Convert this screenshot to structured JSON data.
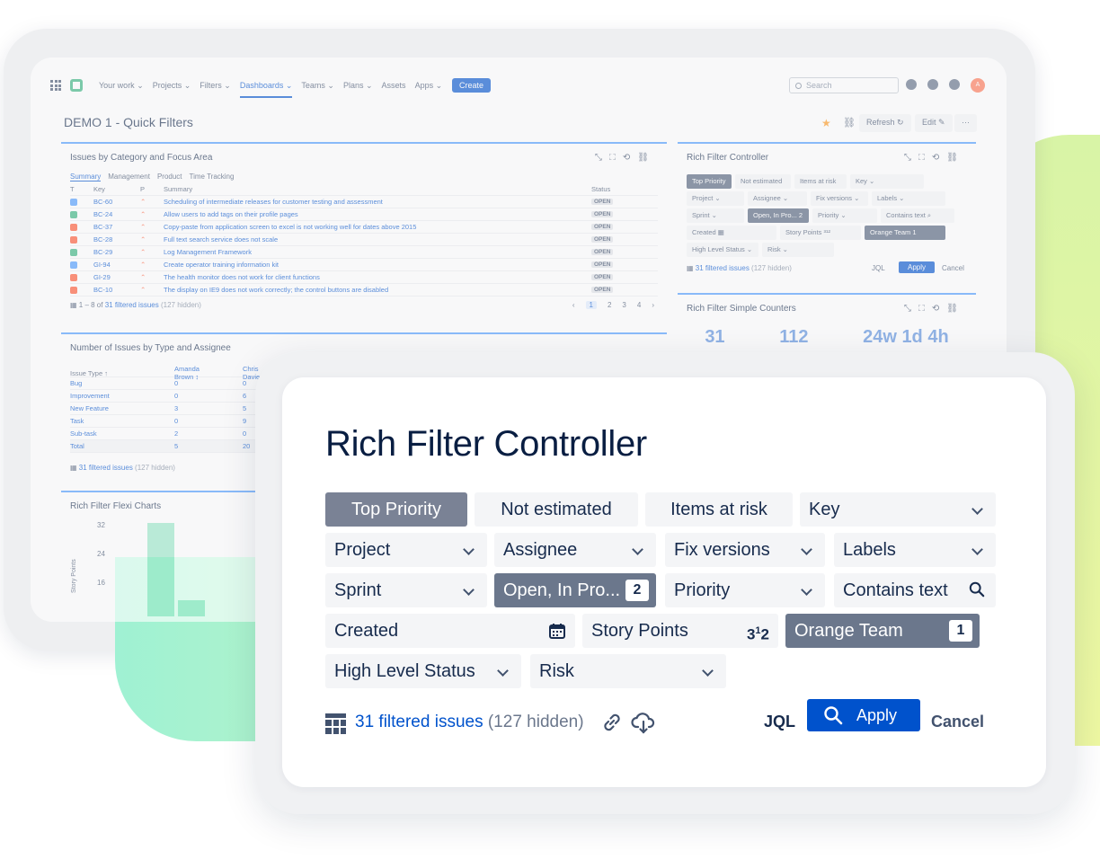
{
  "nav": {
    "items": [
      "Your work ⌄",
      "Projects ⌄",
      "Filters ⌄",
      "Dashboards ⌄",
      "Teams ⌄",
      "Plans ⌄",
      "Assets",
      "Apps ⌄"
    ],
    "create": "Create",
    "search_placeholder": "Search",
    "avatar": "A"
  },
  "dashboard": {
    "title": "DEMO 1 - Quick Filters",
    "refresh": "Refresh ↻",
    "edit": "Edit ✎",
    "more": "···"
  },
  "issues_gadget": {
    "title": "Issues by Category and Focus Area",
    "tabs": [
      "Summary",
      "Management",
      "Product",
      "Time Tracking"
    ],
    "headers": [
      "T",
      "Key",
      "P",
      "Summary",
      "Status"
    ],
    "rows": [
      {
        "type": "task",
        "key": "BC-60",
        "summary": "Scheduling of intermediate releases for customer testing and assessment",
        "status": "OPEN"
      },
      {
        "type": "story",
        "key": "BC-24",
        "summary": "Allow users to add tags on their profile pages",
        "status": "OPEN"
      },
      {
        "type": "bug",
        "key": "BC-37",
        "summary": "Copy-paste from application screen to excel is not working well for dates above 2015",
        "status": "OPEN"
      },
      {
        "type": "bug",
        "key": "BC-28",
        "summary": "Full text search service does not scale",
        "status": "OPEN"
      },
      {
        "type": "story",
        "key": "BC-29",
        "summary": "Log Management Framework",
        "status": "OPEN"
      },
      {
        "type": "task",
        "key": "GI-94",
        "summary": "Create operator training information kit",
        "status": "OPEN"
      },
      {
        "type": "bug",
        "key": "GI-29",
        "summary": "The health monitor does not work for client functions",
        "status": "OPEN"
      },
      {
        "type": "bug",
        "key": "BC-10",
        "summary": "The display on IE9 does not work correctly; the control buttons are disabled",
        "status": "OPEN"
      }
    ],
    "footer_range": "1 – 8 of",
    "footer_link": "31 filtered issues",
    "footer_hidden": "(127 hidden)",
    "pages": [
      "‹",
      "1",
      "2",
      "3",
      "4",
      "›"
    ]
  },
  "type_gadget": {
    "title": "Number of Issues by Type and Assignee",
    "col1": "Issue Type ↑",
    "col2": "Amanda Brown ↕",
    "col3": "Chris Davies",
    "rows": [
      {
        "name": "Bug",
        "a": "0",
        "b": "0"
      },
      {
        "name": "Improvement",
        "a": "0",
        "b": "6"
      },
      {
        "name": "New Feature",
        "a": "3",
        "b": "5"
      },
      {
        "name": "Task",
        "a": "0",
        "b": "9"
      },
      {
        "name": "Sub-task",
        "a": "2",
        "b": "0"
      }
    ],
    "total": {
      "name": "Total",
      "a": "5",
      "b": "20"
    },
    "footer_link": "31 filtered issues",
    "footer_hidden": "(127 hidden)"
  },
  "flexi_gadget": {
    "title": "Rich Filter Flexi Charts",
    "ylabel": "Story Points",
    "ticks": [
      "32",
      "24",
      "16"
    ]
  },
  "mini_controller": {
    "title": "Rich Filter Controller",
    "rows": [
      [
        "Top Priority",
        "Not estimated",
        "Items at risk",
        "Key ⌄"
      ],
      [
        "Project ⌄",
        "Assignee ⌄",
        "Fix versions ⌄",
        "Labels ⌄"
      ],
      [
        "Sprint ⌄",
        "Open, In Pro... 2",
        "Priority ⌄",
        "Contains text ⌕"
      ],
      [
        "Created ▦",
        "Story Points ³¹²",
        "Orange Team 1"
      ],
      [
        "High Level Status ⌄",
        "Risk ⌄"
      ]
    ],
    "footer": "31 filtered issues",
    "footer_hidden": "(127 hidden)",
    "jql": "JQL",
    "apply": "Apply",
    "cancel": "Cancel"
  },
  "counters_gadget": {
    "title": "Rich Filter Simple Counters",
    "values": [
      "31",
      "112",
      "24w 1d 4h"
    ]
  },
  "controller": {
    "title": "Rich Filter Controller",
    "top_priority": "Top Priority",
    "not_estimated": "Not estimated",
    "items_at_risk": "Items at risk",
    "key": "Key",
    "project": "Project",
    "assignee": "Assignee",
    "fix_versions": "Fix versions",
    "labels": "Labels",
    "sprint": "Sprint",
    "status_value": "Open, In Pro...",
    "status_count": "2",
    "priority": "Priority",
    "contains_text": "Contains text",
    "created": "Created",
    "story_points": "Story Points",
    "team": "Orange Team",
    "team_count": "1",
    "high_level_status": "High Level Status",
    "risk": "Risk",
    "filtered": "31 filtered issues",
    "hidden": "(127 hidden)",
    "jql": "JQL",
    "apply": "Apply",
    "cancel": "Cancel"
  },
  "colors": {
    "accent": "#0052cc",
    "chip_bg": "#f4f5f7",
    "chip_selected": "#7a8295",
    "bar": "#57d9a3"
  }
}
